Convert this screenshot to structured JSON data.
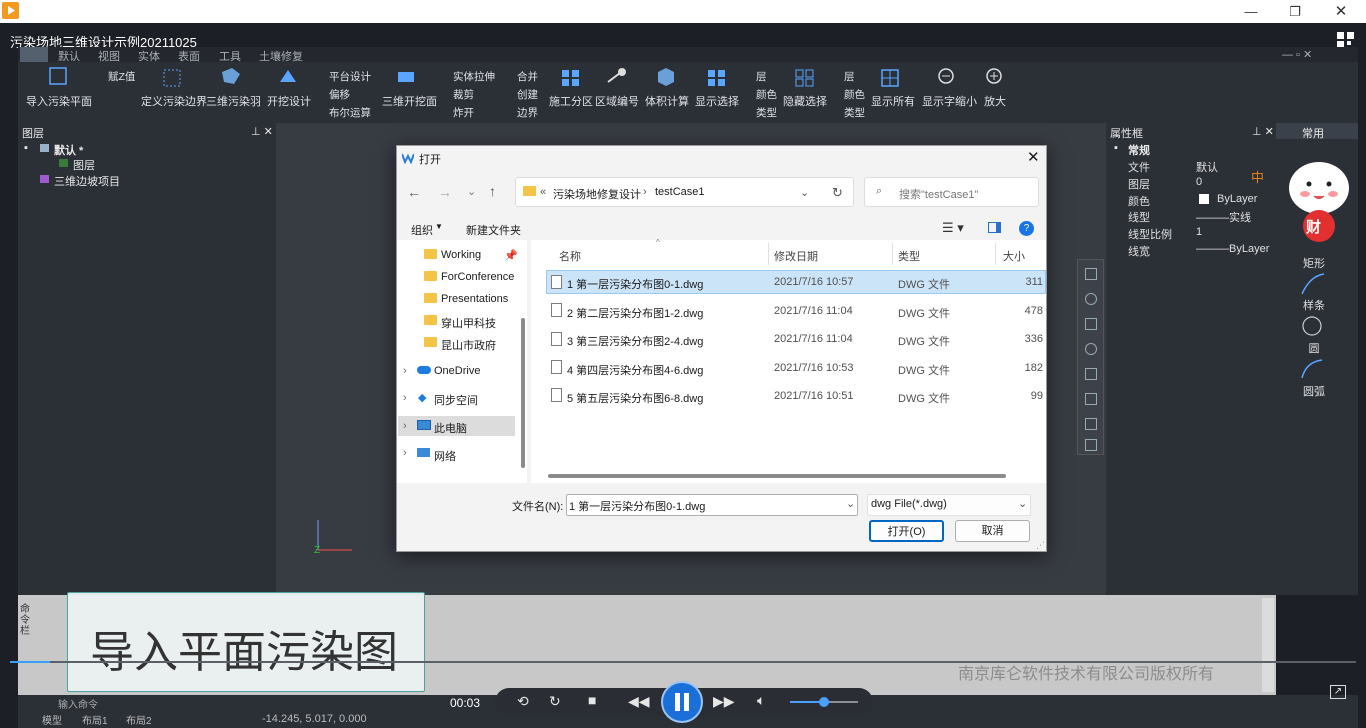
{
  "player": {
    "video_title": "污染场地三维设计示例20211025",
    "time": "00:03",
    "subtitle": "导入平面污染图",
    "watermark": "南京库仑软件技术有限公司版权所有",
    "progress_fraction": 0.03
  },
  "cad": {
    "menu": [
      "默认",
      "视图",
      "实体",
      "表面",
      "工具",
      "土壤修复"
    ],
    "toolbar": {
      "import_plan": "导入污染平面",
      "assign_z": "赋Z值",
      "define_boundary": "定义污染边界",
      "plume_3d": "三维污染羽",
      "excavation_design": "开挖设计",
      "platform_design": "平台设计",
      "offset": "偏移",
      "boolean": "布尔运算",
      "excavation_3d": "三维开挖面",
      "solid_extrude": "实体拉伸",
      "trim": "裁剪",
      "explode": "炸开",
      "merge": "合并",
      "create": "创建",
      "boundary": "边界",
      "construction_zone": "施工分区",
      "zone_number": "区域编号",
      "volume_calc": "体积计算",
      "show_select": "显示选择",
      "layer1": "层",
      "color1": "颜色",
      "type1": "类型",
      "hide_select": "隐藏选择",
      "layer2": "层",
      "color2": "颜色",
      "type2": "类型",
      "show_all": "显示所有",
      "zoom_out_text": "显示字缩小",
      "zoom_in": "放大"
    },
    "layers_panel": {
      "title": "图层",
      "items": [
        "默认 *",
        "图层",
        "三维边坡项目"
      ]
    },
    "props_panel": {
      "title": "属性框",
      "section": "常规",
      "rows": [
        {
          "label": "文件",
          "value": "默认"
        },
        {
          "label": "图层",
          "value": "0"
        },
        {
          "label": "颜色",
          "value": "ByLayer"
        },
        {
          "label": "线型",
          "value": "———实线"
        },
        {
          "label": "线型比例",
          "value": "1"
        },
        {
          "label": "线宽",
          "value": "———ByLayer"
        }
      ]
    },
    "right_tools": {
      "tab": "常用",
      "items": [
        "矩形",
        "样条",
        "圆",
        "圆弧"
      ],
      "mascot_badge": "中",
      "mascot_text": "财"
    },
    "cmd_label": "命令栏",
    "status": {
      "tabs": [
        "模型",
        "布局1",
        "布局2"
      ],
      "coords": "-14.245, 5.017, 0.000",
      "cmd_prompt": "输入命令"
    },
    "axis": {
      "x": "X",
      "y": "Y",
      "z": "Z"
    }
  },
  "dialog": {
    "title": "打开",
    "breadcrumb": [
      "«",
      "污染场地修复设计",
      "testCase1"
    ],
    "search_placeholder": "搜索\"testCase1\"",
    "organize": "组织",
    "new_folder": "新建文件夹",
    "nav": [
      {
        "label": "Working",
        "kind": "folder",
        "pinned": true
      },
      {
        "label": "ForConference",
        "kind": "folder"
      },
      {
        "label": "Presentations",
        "kind": "folder"
      },
      {
        "label": "穿山甲科技",
        "kind": "folder"
      },
      {
        "label": "昆山市政府",
        "kind": "folder"
      },
      {
        "label": "OneDrive",
        "kind": "cloud"
      },
      {
        "label": "同步空间",
        "kind": "sync"
      },
      {
        "label": "此电脑",
        "kind": "pc",
        "selected": true
      },
      {
        "label": "网络",
        "kind": "network"
      }
    ],
    "columns": [
      "名称",
      "修改日期",
      "类型",
      "大小"
    ],
    "files": [
      {
        "name": "1 第一层污染分布图0-1.dwg",
        "date": "2021/7/16 10:57",
        "type": "DWG 文件",
        "size": "311",
        "selected": true
      },
      {
        "name": "2 第二层污染分布图1-2.dwg",
        "date": "2021/7/16 11:04",
        "type": "DWG 文件",
        "size": "478"
      },
      {
        "name": "3 第三层污染分布图2-4.dwg",
        "date": "2021/7/16 11:04",
        "type": "DWG 文件",
        "size": "336"
      },
      {
        "name": "4 第四层污染分布图4-6.dwg",
        "date": "2021/7/16 10:53",
        "type": "DWG 文件",
        "size": "182"
      },
      {
        "name": "5 第五层污染分布图6-8.dwg",
        "date": "2021/7/16 10:51",
        "type": "DWG 文件",
        "size": "99"
      }
    ],
    "filename_label": "文件名(N):",
    "filename_value": "1 第一层污染分布图0-1.dwg",
    "filter_value": "dwg File(*.dwg)",
    "open_button": "打开(O)",
    "cancel_button": "取消"
  }
}
